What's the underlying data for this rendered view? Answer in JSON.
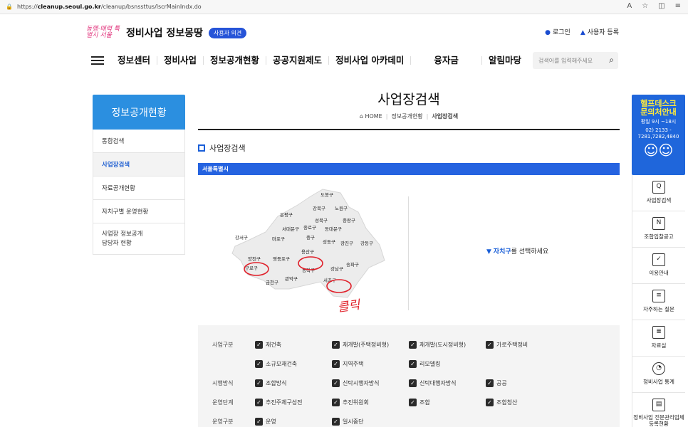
{
  "browser": {
    "url_prefix": "https://",
    "url_host": "cleanup.seoul.go.kr",
    "url_path": "/cleanup/bsnssttus/lscrMainIndx.do"
  },
  "header": {
    "logo_mark": "동행·매력 특별시 서울",
    "site_name": "정비사업 정보몽땅",
    "badge": "사용자 의견",
    "login": "로그인",
    "register": "사용자 등록",
    "search_placeholder": "검색어를 입력해주세요"
  },
  "gnb": [
    "정보센터",
    "정비사업",
    "정보공개현황",
    "공공지원제도",
    "정비사업 아카데미",
    "융자금",
    "알림마당"
  ],
  "sidebar": {
    "title": "정보공개현황",
    "items": [
      {
        "label": "통합검색",
        "active": false
      },
      {
        "label": "사업장검색",
        "active": true
      },
      {
        "label": "자료공개현황",
        "active": false
      },
      {
        "label": "자치구별 운영현황",
        "active": false
      },
      {
        "label": "사업장 정보공개\n담당자 현황",
        "active": false
      }
    ]
  },
  "page": {
    "title": "사업장검색",
    "crumbs": [
      "HOME",
      "정보공개현황",
      "사업장검색"
    ],
    "section": "사업장검색",
    "region_bar": "서울특별시",
    "choose_pre": "자치구",
    "choose_post": "를 선택하세요",
    "annotation": "클릭"
  },
  "districts": [
    {
      "name": "도봉구"
    },
    {
      "name": "강북구"
    },
    {
      "name": "노원구"
    },
    {
      "name": "은평구"
    },
    {
      "name": "성북구"
    },
    {
      "name": "중랑구"
    },
    {
      "name": "서대문구"
    },
    {
      "name": "종로구"
    },
    {
      "name": "동대문구"
    },
    {
      "name": "강서구"
    },
    {
      "name": "마포구"
    },
    {
      "name": "중구"
    },
    {
      "name": "성동구"
    },
    {
      "name": "광진구"
    },
    {
      "name": "강동구"
    },
    {
      "name": "용산구"
    },
    {
      "name": "양천구"
    },
    {
      "name": "영등포구"
    },
    {
      "name": "송파구"
    },
    {
      "name": "구로구"
    },
    {
      "name": "동작구"
    },
    {
      "name": "강남구"
    },
    {
      "name": "서초구"
    },
    {
      "name": "금천구"
    },
    {
      "name": "관악구"
    }
  ],
  "filters": [
    {
      "label": "사업구분",
      "options": [
        "재건축",
        "재개발(주택정비형)",
        "재개발(도시정비형)",
        "가로주택정비"
      ]
    },
    {
      "label": "",
      "options": [
        "소규모재건축",
        "지역주택",
        "리모델링"
      ]
    },
    {
      "label": "시행방식",
      "options": [
        "조합방식",
        "신탁시행자방식",
        "신탁대행자방식",
        "공공"
      ]
    },
    {
      "label": "운영단계",
      "options": [
        "추진주체구성전",
        "추진위원회",
        "조합",
        "조합청산"
      ]
    },
    {
      "label": "운영구분",
      "options": [
        "운영",
        "일시중단"
      ]
    }
  ],
  "quick": {
    "help_title1": "헬프데스크",
    "help_title2": "문의처안내",
    "help_hours": "평일 9시 ~18시",
    "help_phone": "02) 2133 - 7281,7282,4840",
    "items": [
      "사업장검색",
      "조합입찰공고",
      "이용안내",
      "자주하는 질문",
      "자료실",
      "정비사업 통계",
      "정비사업 전문관리업체 등록현황"
    ]
  },
  "colors": {
    "primary": "#2563e0",
    "sidebar_head": "#2b8fe0",
    "annotation": "#e0202a"
  }
}
